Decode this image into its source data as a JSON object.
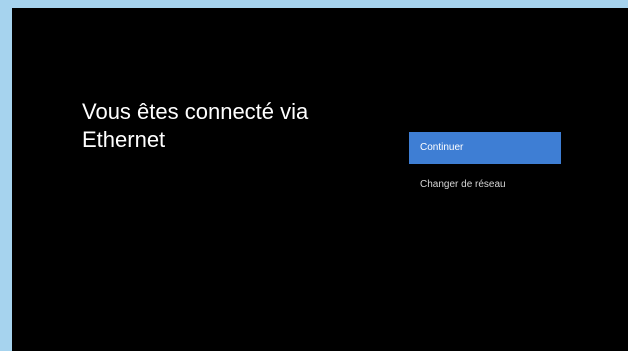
{
  "screen": {
    "title": "Vous êtes connecté via Ethernet"
  },
  "options": [
    {
      "label": "Continuer",
      "focused": true
    },
    {
      "label": "Changer de réseau",
      "focused": false
    }
  ],
  "colors": {
    "background": "#000000",
    "accent": "#3e7ed4",
    "border": "#a6d3ee",
    "text": "#ffffff"
  }
}
